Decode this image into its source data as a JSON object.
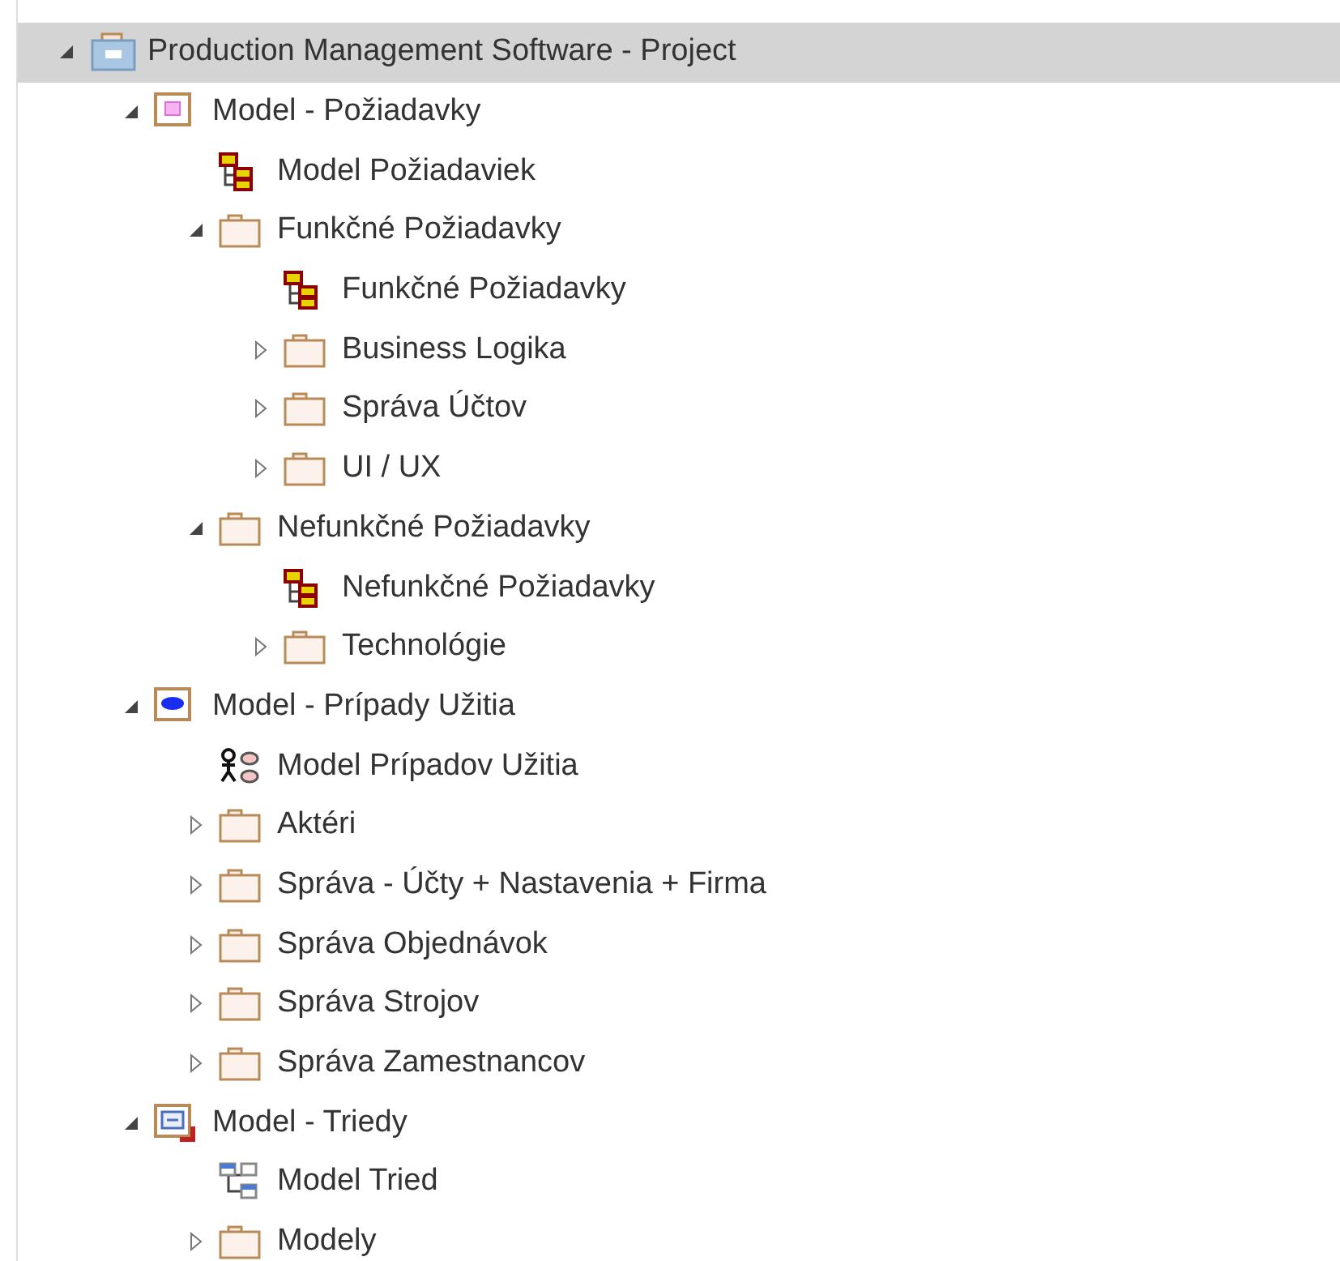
{
  "tree": [
    {
      "label": "Production Management Software - Project",
      "kind": "project",
      "selected": true,
      "expanded": true,
      "children": [
        {
          "label": "Model - Požiadavky",
          "kind": "model-requirements",
          "selected": false,
          "expanded": true,
          "children": [
            {
              "label": "Model Požiadaviek",
              "kind": "diagram-requirements",
              "selected": false
            },
            {
              "label": "Funkčné Požiadavky",
              "kind": "folder",
              "selected": false,
              "expanded": true,
              "children": [
                {
                  "label": "Funkčné Požiadavky",
                  "kind": "diagram-requirements",
                  "selected": false
                },
                {
                  "label": "Business Logika",
                  "kind": "folder",
                  "selected": false,
                  "expanded": false
                },
                {
                  "label": "Správa Účtov",
                  "kind": "folder",
                  "selected": false,
                  "expanded": false
                },
                {
                  "label": "UI / UX",
                  "kind": "folder",
                  "selected": false,
                  "expanded": false
                }
              ]
            },
            {
              "label": "Nefunkčné Požiadavky",
              "kind": "folder",
              "selected": false,
              "expanded": true,
              "children": [
                {
                  "label": "Nefunkčné Požiadavky",
                  "kind": "diagram-requirements",
                  "selected": false
                },
                {
                  "label": "Technológie",
                  "kind": "folder",
                  "selected": false,
                  "expanded": false
                }
              ]
            }
          ]
        },
        {
          "label": "Model - Prípady Užitia",
          "kind": "model-usecases",
          "selected": false,
          "expanded": true,
          "children": [
            {
              "label": "Model Prípadov Užitia",
              "kind": "diagram-usecases",
              "selected": false
            },
            {
              "label": "Aktéri",
              "kind": "folder",
              "selected": false,
              "expanded": false
            },
            {
              "label": "Správa - Účty + Nastavenia + Firma",
              "kind": "folder",
              "selected": false,
              "expanded": false
            },
            {
              "label": "Správa Objednávok",
              "kind": "folder",
              "selected": false,
              "expanded": false
            },
            {
              "label": "Správa Strojov",
              "kind": "folder",
              "selected": false,
              "expanded": false
            },
            {
              "label": "Správa Zamestnancov",
              "kind": "folder",
              "selected": false,
              "expanded": false
            }
          ]
        },
        {
          "label": "Model - Triedy",
          "kind": "model-classes",
          "selected": false,
          "expanded": true,
          "children": [
            {
              "label": "Model Tried",
              "kind": "diagram-classes",
              "selected": false
            },
            {
              "label": "Modely",
              "kind": "folder",
              "selected": false,
              "expanded": false
            }
          ]
        }
      ]
    }
  ]
}
